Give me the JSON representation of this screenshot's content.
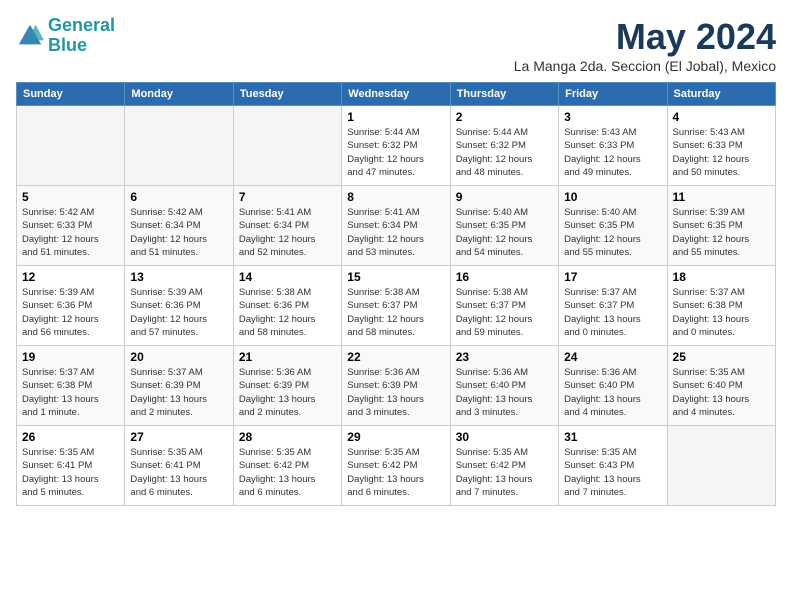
{
  "logo": {
    "line1": "General",
    "line2": "Blue"
  },
  "title": "May 2024",
  "subtitle": "La Manga 2da. Seccion (El Jobal), Mexico",
  "headers": [
    "Sunday",
    "Monday",
    "Tuesday",
    "Wednesday",
    "Thursday",
    "Friday",
    "Saturday"
  ],
  "weeks": [
    [
      {
        "day": "",
        "info": ""
      },
      {
        "day": "",
        "info": ""
      },
      {
        "day": "",
        "info": ""
      },
      {
        "day": "1",
        "info": "Sunrise: 5:44 AM\nSunset: 6:32 PM\nDaylight: 12 hours\nand 47 minutes."
      },
      {
        "day": "2",
        "info": "Sunrise: 5:44 AM\nSunset: 6:32 PM\nDaylight: 12 hours\nand 48 minutes."
      },
      {
        "day": "3",
        "info": "Sunrise: 5:43 AM\nSunset: 6:33 PM\nDaylight: 12 hours\nand 49 minutes."
      },
      {
        "day": "4",
        "info": "Sunrise: 5:43 AM\nSunset: 6:33 PM\nDaylight: 12 hours\nand 50 minutes."
      }
    ],
    [
      {
        "day": "5",
        "info": "Sunrise: 5:42 AM\nSunset: 6:33 PM\nDaylight: 12 hours\nand 51 minutes."
      },
      {
        "day": "6",
        "info": "Sunrise: 5:42 AM\nSunset: 6:34 PM\nDaylight: 12 hours\nand 51 minutes."
      },
      {
        "day": "7",
        "info": "Sunrise: 5:41 AM\nSunset: 6:34 PM\nDaylight: 12 hours\nand 52 minutes."
      },
      {
        "day": "8",
        "info": "Sunrise: 5:41 AM\nSunset: 6:34 PM\nDaylight: 12 hours\nand 53 minutes."
      },
      {
        "day": "9",
        "info": "Sunrise: 5:40 AM\nSunset: 6:35 PM\nDaylight: 12 hours\nand 54 minutes."
      },
      {
        "day": "10",
        "info": "Sunrise: 5:40 AM\nSunset: 6:35 PM\nDaylight: 12 hours\nand 55 minutes."
      },
      {
        "day": "11",
        "info": "Sunrise: 5:39 AM\nSunset: 6:35 PM\nDaylight: 12 hours\nand 55 minutes."
      }
    ],
    [
      {
        "day": "12",
        "info": "Sunrise: 5:39 AM\nSunset: 6:36 PM\nDaylight: 12 hours\nand 56 minutes."
      },
      {
        "day": "13",
        "info": "Sunrise: 5:39 AM\nSunset: 6:36 PM\nDaylight: 12 hours\nand 57 minutes."
      },
      {
        "day": "14",
        "info": "Sunrise: 5:38 AM\nSunset: 6:36 PM\nDaylight: 12 hours\nand 58 minutes."
      },
      {
        "day": "15",
        "info": "Sunrise: 5:38 AM\nSunset: 6:37 PM\nDaylight: 12 hours\nand 58 minutes."
      },
      {
        "day": "16",
        "info": "Sunrise: 5:38 AM\nSunset: 6:37 PM\nDaylight: 12 hours\nand 59 minutes."
      },
      {
        "day": "17",
        "info": "Sunrise: 5:37 AM\nSunset: 6:37 PM\nDaylight: 13 hours\nand 0 minutes."
      },
      {
        "day": "18",
        "info": "Sunrise: 5:37 AM\nSunset: 6:38 PM\nDaylight: 13 hours\nand 0 minutes."
      }
    ],
    [
      {
        "day": "19",
        "info": "Sunrise: 5:37 AM\nSunset: 6:38 PM\nDaylight: 13 hours\nand 1 minute."
      },
      {
        "day": "20",
        "info": "Sunrise: 5:37 AM\nSunset: 6:39 PM\nDaylight: 13 hours\nand 2 minutes."
      },
      {
        "day": "21",
        "info": "Sunrise: 5:36 AM\nSunset: 6:39 PM\nDaylight: 13 hours\nand 2 minutes."
      },
      {
        "day": "22",
        "info": "Sunrise: 5:36 AM\nSunset: 6:39 PM\nDaylight: 13 hours\nand 3 minutes."
      },
      {
        "day": "23",
        "info": "Sunrise: 5:36 AM\nSunset: 6:40 PM\nDaylight: 13 hours\nand 3 minutes."
      },
      {
        "day": "24",
        "info": "Sunrise: 5:36 AM\nSunset: 6:40 PM\nDaylight: 13 hours\nand 4 minutes."
      },
      {
        "day": "25",
        "info": "Sunrise: 5:35 AM\nSunset: 6:40 PM\nDaylight: 13 hours\nand 4 minutes."
      }
    ],
    [
      {
        "day": "26",
        "info": "Sunrise: 5:35 AM\nSunset: 6:41 PM\nDaylight: 13 hours\nand 5 minutes."
      },
      {
        "day": "27",
        "info": "Sunrise: 5:35 AM\nSunset: 6:41 PM\nDaylight: 13 hours\nand 6 minutes."
      },
      {
        "day": "28",
        "info": "Sunrise: 5:35 AM\nSunset: 6:42 PM\nDaylight: 13 hours\nand 6 minutes."
      },
      {
        "day": "29",
        "info": "Sunrise: 5:35 AM\nSunset: 6:42 PM\nDaylight: 13 hours\nand 6 minutes."
      },
      {
        "day": "30",
        "info": "Sunrise: 5:35 AM\nSunset: 6:42 PM\nDaylight: 13 hours\nand 7 minutes."
      },
      {
        "day": "31",
        "info": "Sunrise: 5:35 AM\nSunset: 6:43 PM\nDaylight: 13 hours\nand 7 minutes."
      },
      {
        "day": "",
        "info": ""
      }
    ]
  ]
}
